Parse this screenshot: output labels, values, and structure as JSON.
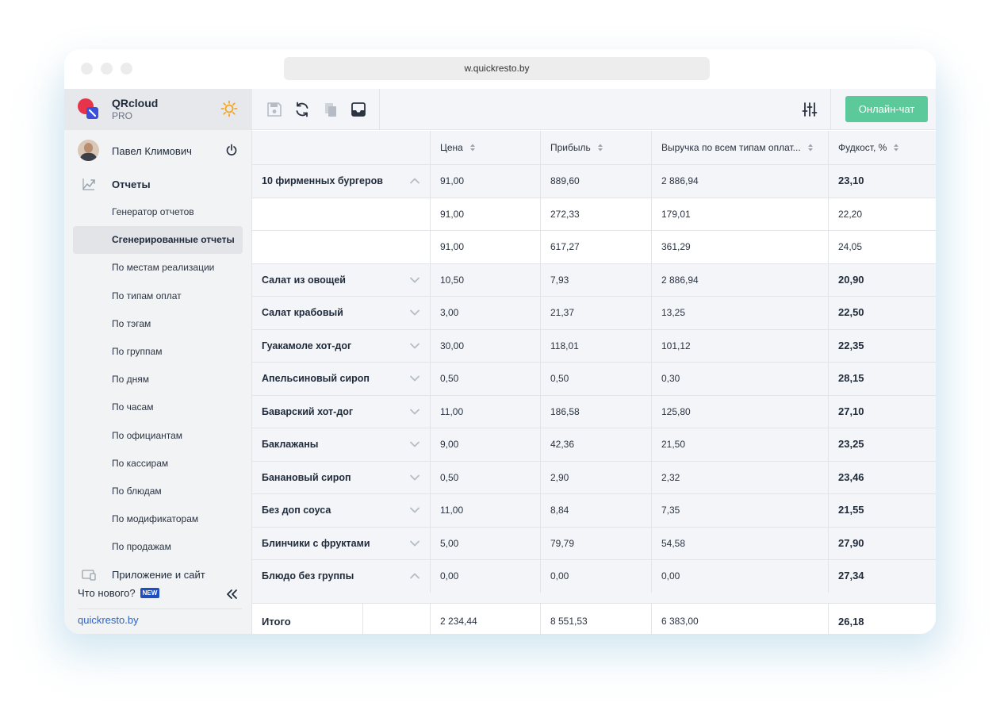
{
  "browser": {
    "url": "w.quickresto.by"
  },
  "brand": {
    "name": "QRcloud",
    "tier": "PRO"
  },
  "user": {
    "name": "Павел Климович"
  },
  "nav": {
    "section": "Отчеты",
    "items": [
      {
        "label": "Генератор отчетов",
        "active": false
      },
      {
        "label": "Сгенерированные отчеты",
        "active": true
      },
      {
        "label": "По местам реализации",
        "active": false
      },
      {
        "label": "По типам оплат",
        "active": false
      },
      {
        "label": "По тэгам",
        "active": false
      },
      {
        "label": "По группам",
        "active": false
      },
      {
        "label": "По дням",
        "active": false
      },
      {
        "label": "По часам",
        "active": false
      },
      {
        "label": "По официантам",
        "active": false
      },
      {
        "label": "По кассирам",
        "active": false
      },
      {
        "label": "По блюдам",
        "active": false
      },
      {
        "label": "По модификаторам",
        "active": false
      },
      {
        "label": "По продажам",
        "active": false
      }
    ],
    "app_site": "Приложение и сайт",
    "whats_new": "Что нового?",
    "new_badge": "NEW",
    "site_link": "quickresto.by"
  },
  "toolbar": {
    "chat_label": "Онлайн-чат"
  },
  "table": {
    "columns": [
      "",
      "Цена",
      "Прибыль",
      "Выручка по всем типам оплат...",
      "Фудкост, %"
    ],
    "rows": [
      {
        "type": "group",
        "name": "10 фирменных бургеров",
        "expanded": true,
        "price": "91,00",
        "profit": "889,60",
        "revenue": "2 886,94",
        "foodcost": "23,10"
      },
      {
        "type": "child",
        "name": "",
        "price": "91,00",
        "profit": "272,33",
        "revenue": "179,01",
        "foodcost": "22,20"
      },
      {
        "type": "child",
        "name": "",
        "price": "91,00",
        "profit": "617,27",
        "revenue": "361,29",
        "foodcost": "24,05"
      },
      {
        "type": "group",
        "name": "Салат из овощей",
        "expanded": false,
        "price": "10,50",
        "profit": "7,93",
        "revenue": "2 886,94",
        "foodcost": "20,90"
      },
      {
        "type": "group",
        "name": "Салат крабовый",
        "expanded": false,
        "price": "3,00",
        "profit": "21,37",
        "revenue": "13,25",
        "foodcost": "22,50"
      },
      {
        "type": "group",
        "name": "Гуакамоле хот-дог",
        "expanded": false,
        "price": "30,00",
        "profit": "118,01",
        "revenue": "101,12",
        "foodcost": "22,35"
      },
      {
        "type": "group",
        "name": "Апельсиновый сироп",
        "expanded": false,
        "price": "0,50",
        "profit": "0,50",
        "revenue": "0,30",
        "foodcost": "28,15"
      },
      {
        "type": "group",
        "name": "Баварский хот-дог",
        "expanded": false,
        "price": "11,00",
        "profit": "186,58",
        "revenue": "125,80",
        "foodcost": "27,10"
      },
      {
        "type": "group",
        "name": "Баклажаны",
        "expanded": false,
        "price": "9,00",
        "profit": "42,36",
        "revenue": "21,50",
        "foodcost": "23,25"
      },
      {
        "type": "group",
        "name": "Банановый сироп",
        "expanded": false,
        "price": "0,50",
        "profit": "2,90",
        "revenue": "2,32",
        "foodcost": "23,46"
      },
      {
        "type": "group",
        "name": "Без доп соуса",
        "expanded": false,
        "price": "11,00",
        "profit": "8,84",
        "revenue": "7,35",
        "foodcost": "21,55"
      },
      {
        "type": "group",
        "name": "Блинчики с фруктами",
        "expanded": false,
        "price": "5,00",
        "profit": "79,79",
        "revenue": "54,58",
        "foodcost": "27,90"
      },
      {
        "type": "group",
        "name": "Блюдо без группы",
        "expanded": true,
        "price": "0,00",
        "profit": "0,00",
        "revenue": "0,00",
        "foodcost": "27,34"
      }
    ],
    "total": {
      "label": "Итого",
      "price": "2 234,44",
      "profit": "8 551,53",
      "revenue": "6 383,00",
      "foodcost": "26,18"
    }
  },
  "colors": {
    "accent_green": "#5cc99a",
    "link_blue": "#2b64c8",
    "badge_blue": "#1f4fbf",
    "logo_red": "#e8344a",
    "logo_blue": "#3b4fd8",
    "sun_orange": "#f5a623"
  }
}
